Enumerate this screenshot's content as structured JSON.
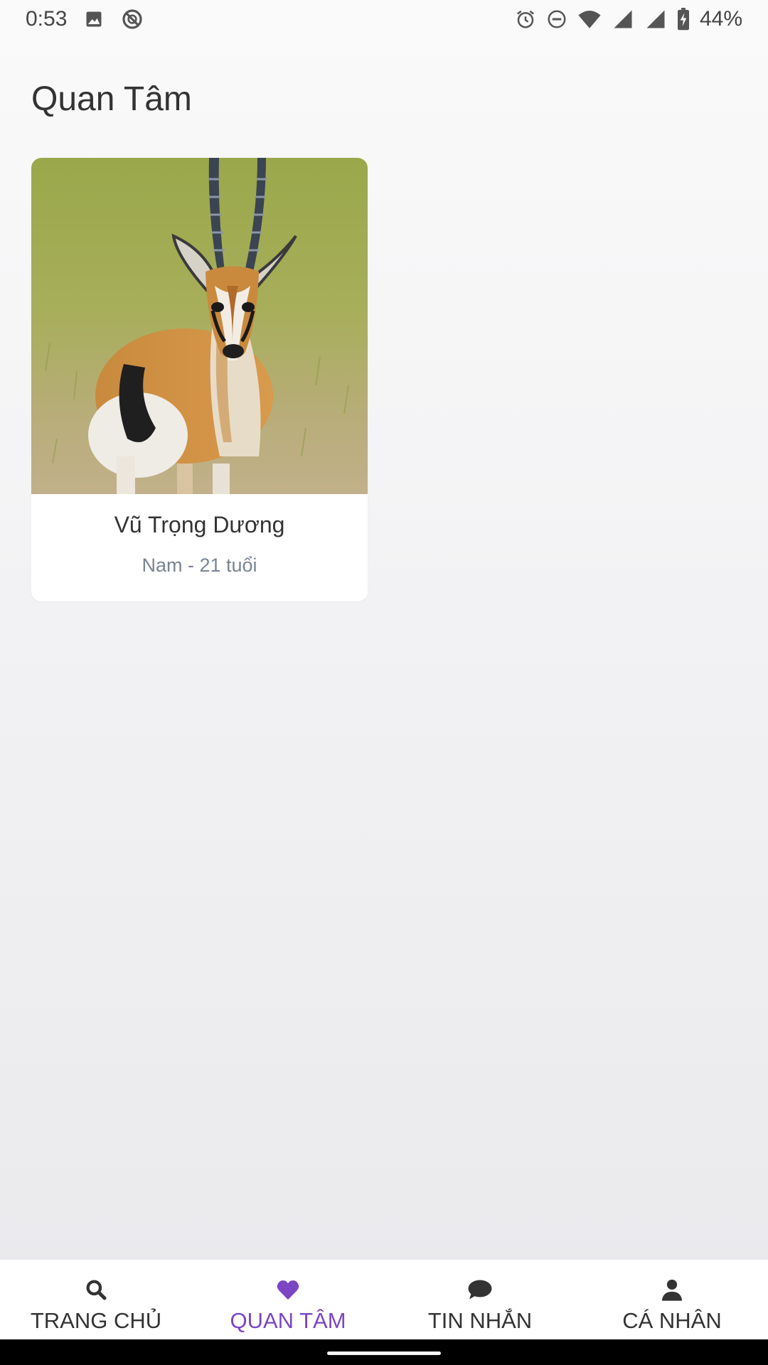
{
  "status_bar": {
    "time": "0:53",
    "battery": "44%",
    "left_icons": [
      "image-icon",
      "sync-disabled-icon"
    ],
    "right_icons": [
      "alarm-icon",
      "do-not-disturb-icon",
      "wifi-icon",
      "signal-icon",
      "signal-icon",
      "battery-charging-icon"
    ]
  },
  "page": {
    "title": "Quan Tâm"
  },
  "cards": [
    {
      "name": "Vũ Trọng Dương",
      "subtitle": "Nam - 21 tuổi",
      "image": "gazelle-photo"
    }
  ],
  "bottom_nav": {
    "active_index": 1,
    "active_color": "#7b45c4",
    "items": [
      {
        "label": "TRANG CHỦ",
        "icon": "search-icon"
      },
      {
        "label": "QUAN TÂM",
        "icon": "heart-icon"
      },
      {
        "label": "TIN NHẮN",
        "icon": "chat-bubble-icon"
      },
      {
        "label": "CÁ NHÂN",
        "icon": "person-icon"
      }
    ]
  }
}
